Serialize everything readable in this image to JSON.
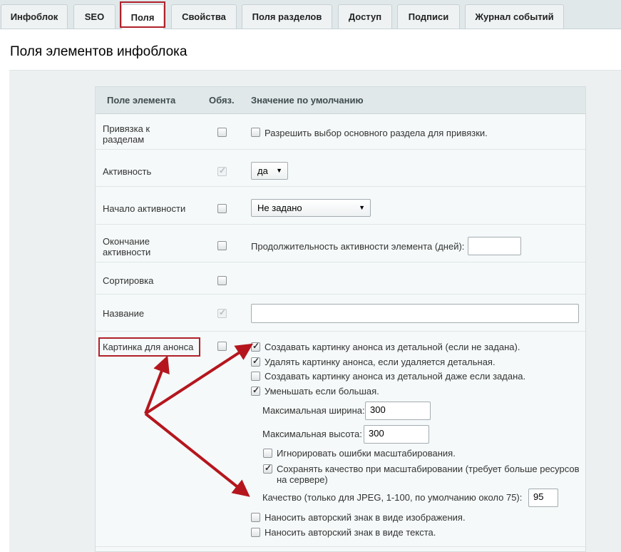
{
  "tabs": [
    {
      "label": "Инфоблок"
    },
    {
      "label": "SEO"
    },
    {
      "label": "Поля",
      "active": true
    },
    {
      "label": "Свойства"
    },
    {
      "label": "Поля разделов"
    },
    {
      "label": "Доступ"
    },
    {
      "label": "Подписи"
    },
    {
      "label": "Журнал событий"
    }
  ],
  "section_title": "Поля элементов инфоблока",
  "table": {
    "headers": {
      "field": "Поле элемента",
      "required": "Обяз.",
      "default": "Значение по умолчанию"
    },
    "rows": {
      "section_link": {
        "label": "Привязка к разделам",
        "required": false,
        "option": {
          "label": "Разрешить выбор основного раздела для привязки.",
          "checked": false
        }
      },
      "active": {
        "label": "Активность",
        "required": true,
        "required_disabled": true,
        "select_value": "да"
      },
      "active_from": {
        "label": "Начало активности",
        "required": false,
        "select_value": "Не задано"
      },
      "active_to": {
        "label": "Окончание активности",
        "required": false,
        "duration_label": "Продолжительность активности элемента (дней):",
        "duration_value": ""
      },
      "sort": {
        "label": "Сортировка",
        "required": false
      },
      "name": {
        "label": "Название",
        "required": true,
        "required_disabled": true,
        "value": ""
      },
      "preview_picture": {
        "label": "Картинка для анонса",
        "required": false,
        "options": [
          {
            "label": "Создавать картинку анонса из детальной (если не задана).",
            "checked": true
          },
          {
            "label": "Удалять картинку анонса, если удаляется детальная.",
            "checked": true
          },
          {
            "label": "Создавать картинку анонса из детальной даже если задана.",
            "checked": false
          },
          {
            "label": "Уменьшать если большая.",
            "checked": true
          }
        ],
        "max_width_label": "Максимальная ширина:",
        "max_width_value": "300",
        "max_height_label": "Максимальная высота:",
        "max_height_value": "300",
        "ignore_errors": {
          "label": "Игнорировать ошибки масштабирования.",
          "checked": false
        },
        "keep_quality": {
          "label_line1": "Сохранять качество при масштабировании (требует больше ресурсов",
          "label_line2": "на сервере)",
          "checked": true
        },
        "quality_label": "Качество (только для JPEG, 1-100, по умолчанию около 75):",
        "quality_value": "95",
        "watermark_image": {
          "label": "Наносить авторский знак в виде изображения.",
          "checked": false
        },
        "watermark_text": {
          "label": "Наносить авторский знак в виде текста.",
          "checked": false
        }
      }
    }
  },
  "colors": {
    "highlight": "#b0212a",
    "arrow": "#b5161e",
    "header_bg": "#e0e8ea",
    "table_bg": "#f5f9f9"
  }
}
